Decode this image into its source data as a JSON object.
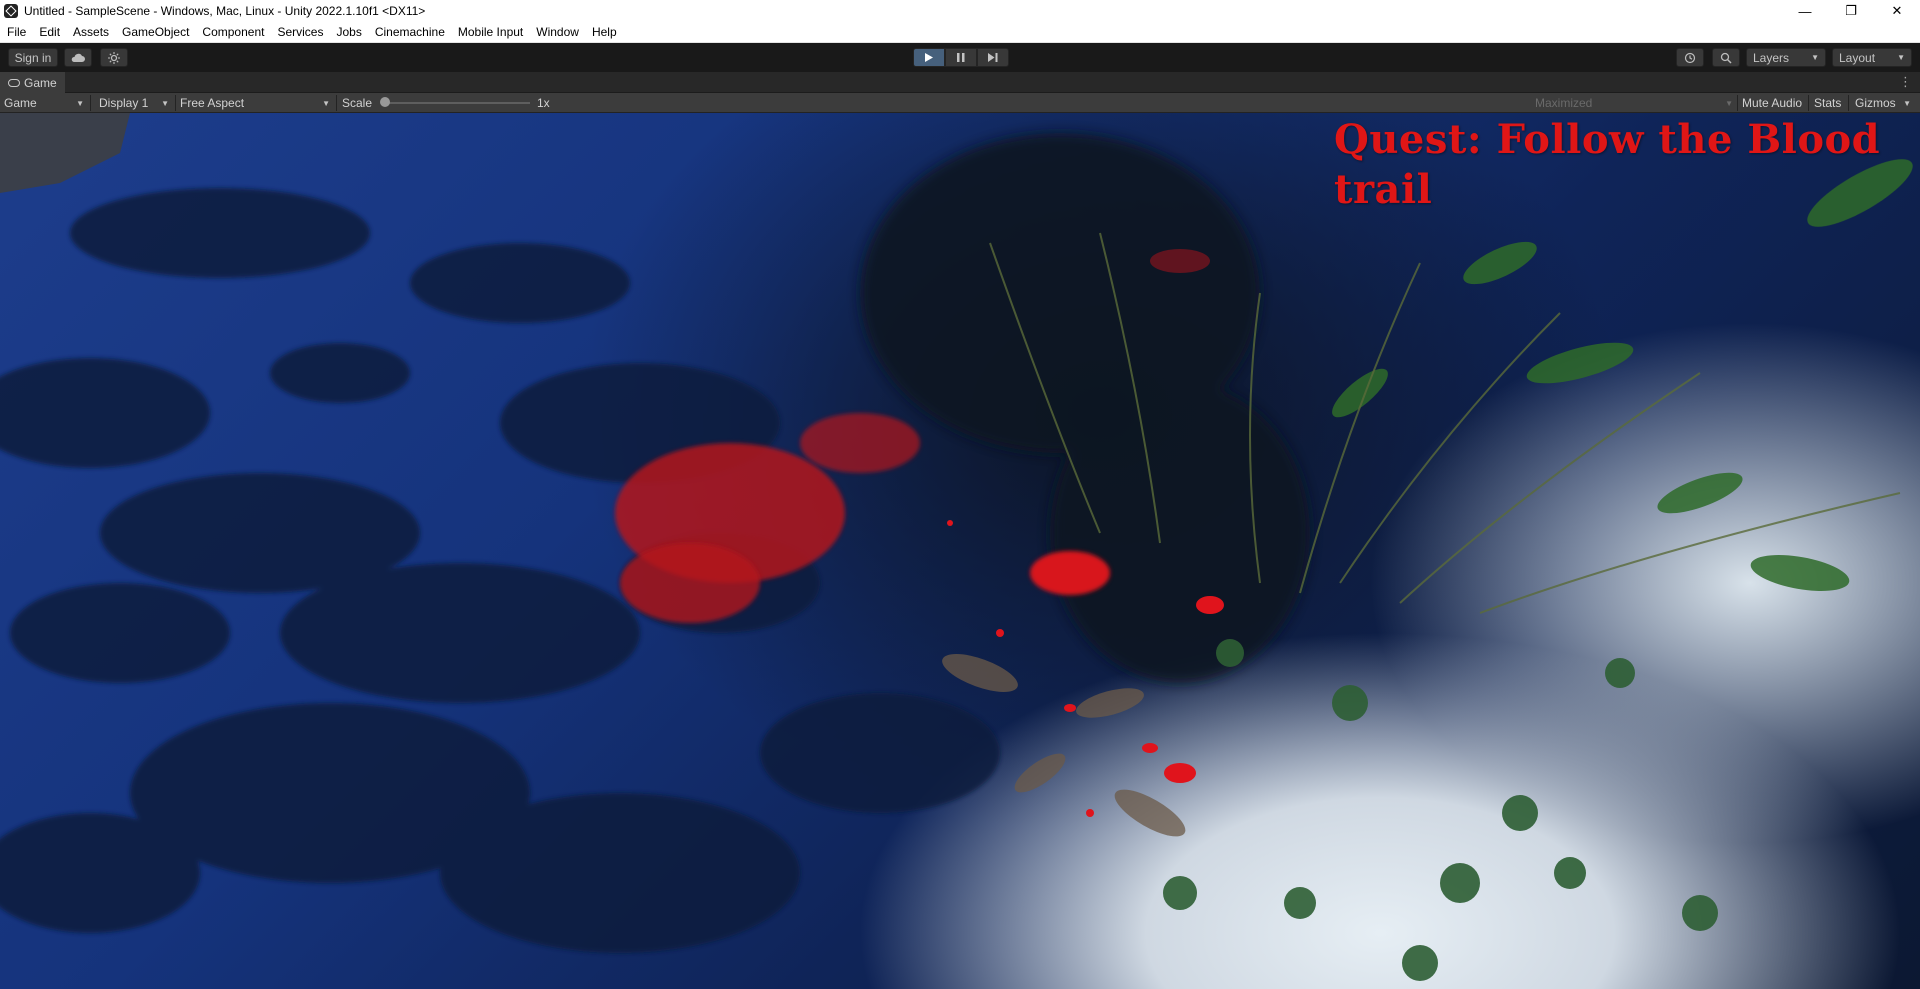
{
  "window": {
    "title": "Untitled - SampleScene - Windows, Mac, Linux - Unity 2022.1.10f1 <DX11>",
    "minimize_icon": "minimize-icon",
    "maximize_icon": "restore-icon",
    "close_icon": "close-icon"
  },
  "menu": {
    "items": [
      "File",
      "Edit",
      "Assets",
      "GameObject",
      "Component",
      "Services",
      "Jobs",
      "Cinemachine",
      "Mobile Input",
      "Window",
      "Help"
    ]
  },
  "toolbar": {
    "sign_in": "Sign in",
    "cloud_icon": "cloud-icon",
    "collab_icon": "collab-icon",
    "play_icon": "play-icon",
    "pause_icon": "pause-icon",
    "step_icon": "step-icon",
    "history_icon": "history-icon",
    "search_icon": "search-icon",
    "layers": "Layers",
    "layout": "Layout",
    "play_active_color": "#46607c"
  },
  "tab": {
    "label": "Game",
    "icon": "gamepad-icon"
  },
  "gamebar": {
    "view_select": "Game",
    "display": "Display 1",
    "aspect": "Free Aspect",
    "scale_label": "Scale",
    "scale_value": "1x",
    "scale_level": 0,
    "maximized": "Maximized",
    "mute_audio": "Mute Audio",
    "stats": "Stats",
    "gizmos": "Gizmos"
  },
  "game": {
    "quest_text": "Quest: Follow the Blood trail",
    "quest_color": "#e01616"
  }
}
